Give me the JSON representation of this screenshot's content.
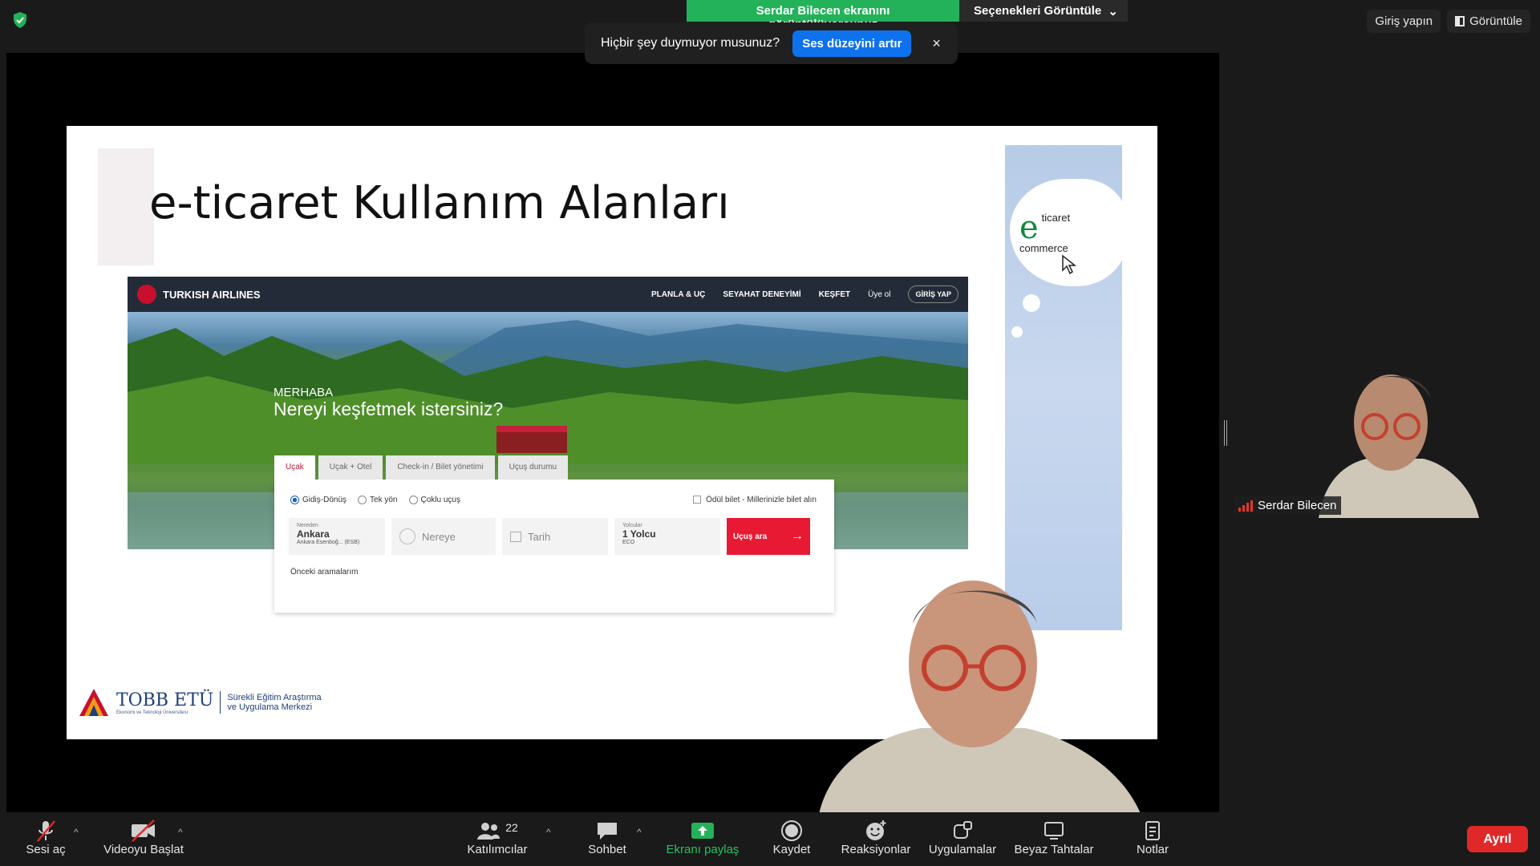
{
  "top_bar": {
    "share_status": "Serdar Bilecen ekranını görüntülüyorsunuz",
    "view_options": "Seçenekleri Görüntüle",
    "sign_in": "Giriş yapın",
    "view": "Görüntüle"
  },
  "audio_toast": {
    "message": "Hiçbir şey duymuyor musunuz?",
    "button": "Ses düzeyini artır",
    "close": "×"
  },
  "slide": {
    "title": "e-ticaret Kullanım Alanları",
    "turkish_airlines": {
      "logo": "TURKISH AIRLINES",
      "nav": [
        "PLANLA & UÇ",
        "SEYAHAT DENEYİMİ",
        "KEŞFET",
        "Üye ol"
      ],
      "login": "GİRİŞ YAP",
      "greeting": "MERHABA",
      "headline": "Nereyi keşfetmek istersiniz?",
      "tabs": [
        "Uçak",
        "Uçak + Otel",
        "Check-in / Bilet yönetimi",
        "Uçuş durumu"
      ],
      "radios": [
        "Gidiş-Dönüş",
        "Tek yön",
        "Çoklu uçuş"
      ],
      "award": "Ödül bilet - Millerinizle bilet alın",
      "from_label": "Nereden",
      "from_value": "Ankara",
      "from_sub": "Ankara Esenboğ... (ESB)",
      "to_placeholder": "Nereye",
      "date_placeholder": "Tarih",
      "pax_label": "Yolcular",
      "pax_value": "1 Yolcu",
      "pax_class": "ECO",
      "search": "Uçuş ara",
      "previous": "Önceki aramalarım"
    },
    "side_logo": {
      "line1": "ticaret",
      "line2": "commerce"
    },
    "tobb": {
      "name": "TOBB ETÜ",
      "sub": "Ekonomi ve Teknoloji Üniversitesi",
      "right1": "Sürekli Eğitim Araştırma",
      "right2": "ve Uygulama Merkezi"
    }
  },
  "participant": {
    "name": "Serdar Bilecen"
  },
  "toolbar": {
    "unmute": "Sesi aç",
    "start_video": "Videoyu Başlat",
    "participants": "Katılımcılar",
    "participants_count": "22",
    "chat": "Sohbet",
    "share_screen": "Ekranı paylaş",
    "record": "Kaydet",
    "reactions": "Reaksiyonlar",
    "apps": "Uygulamalar",
    "whiteboards": "Beyaz Tahtalar",
    "notes": "Notlar",
    "leave": "Ayrıl"
  },
  "colors": {
    "share_green": "#23b25a",
    "toast_button": "#0e72ed",
    "leave_red": "#e02828",
    "ta_red": "#e81932"
  }
}
